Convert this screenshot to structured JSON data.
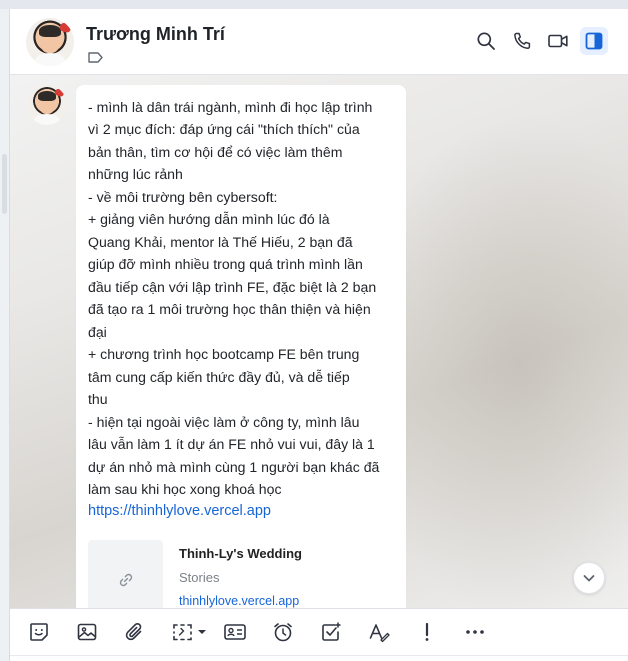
{
  "header": {
    "contact_name": "Trương Minh Trí",
    "actions": [
      {
        "name": "search-icon"
      },
      {
        "name": "phone-icon"
      },
      {
        "name": "video-call-icon"
      },
      {
        "name": "sidebar-toggle-icon"
      }
    ]
  },
  "message": {
    "text": "- mình là dân trái ngành, mình đi học lập trình\nvì 2 mục đích: đáp ứng cái \"thích thích\" của\nbản thân, tìm cơ hội để có việc làm thêm\nnhững lúc rảnh\n- về môi trường bên cybersoft:\n+ giảng viên hướng dẫn mình lúc đó là\nQuang Khải, mentor là Thế Hiếu, 2 bạn đã\ngiúp đỡ mình nhiều trong quá trình mình lần\nđầu tiếp cận với lập trình FE, đặc biệt là 2 bạn\nđã tạo ra 1 môi trường học thân thiện và hiện\nđại\n+ chương trình học bootcamp FE bên trung\ntâm cung cấp kiến thức đầy đủ, và dễ tiếp\nthu\n- hiện tại ngoài việc làm ở công ty, mình lâu\nlâu vẫn làm 1 ít dự án FE nhỏ vui vui, đây là 1\ndự án nhỏ mà mình cùng 1 người bạn khác đã\nlàm sau khi học xong khoá học",
    "link": "https://thinhlylove.vercel.app",
    "preview": {
      "title": "Thinh-Ly's Wedding",
      "subtitle": "Stories",
      "domain": "thinhlylove.vercel.app"
    }
  },
  "toolbar": {
    "items": [
      {
        "name": "sticker-icon"
      },
      {
        "name": "image-icon"
      },
      {
        "name": "attachment-icon"
      },
      {
        "name": "screenshot-icon"
      },
      {
        "name": "contact-card-icon"
      },
      {
        "name": "reminder-clock-icon"
      },
      {
        "name": "task-icon"
      },
      {
        "name": "text-format-icon"
      },
      {
        "name": "important-icon"
      },
      {
        "name": "more-icon"
      }
    ]
  },
  "colors": {
    "accent": "#1665d8",
    "active_bg": "#e5efff",
    "text": "#22252a",
    "icon": "#2f3440"
  }
}
